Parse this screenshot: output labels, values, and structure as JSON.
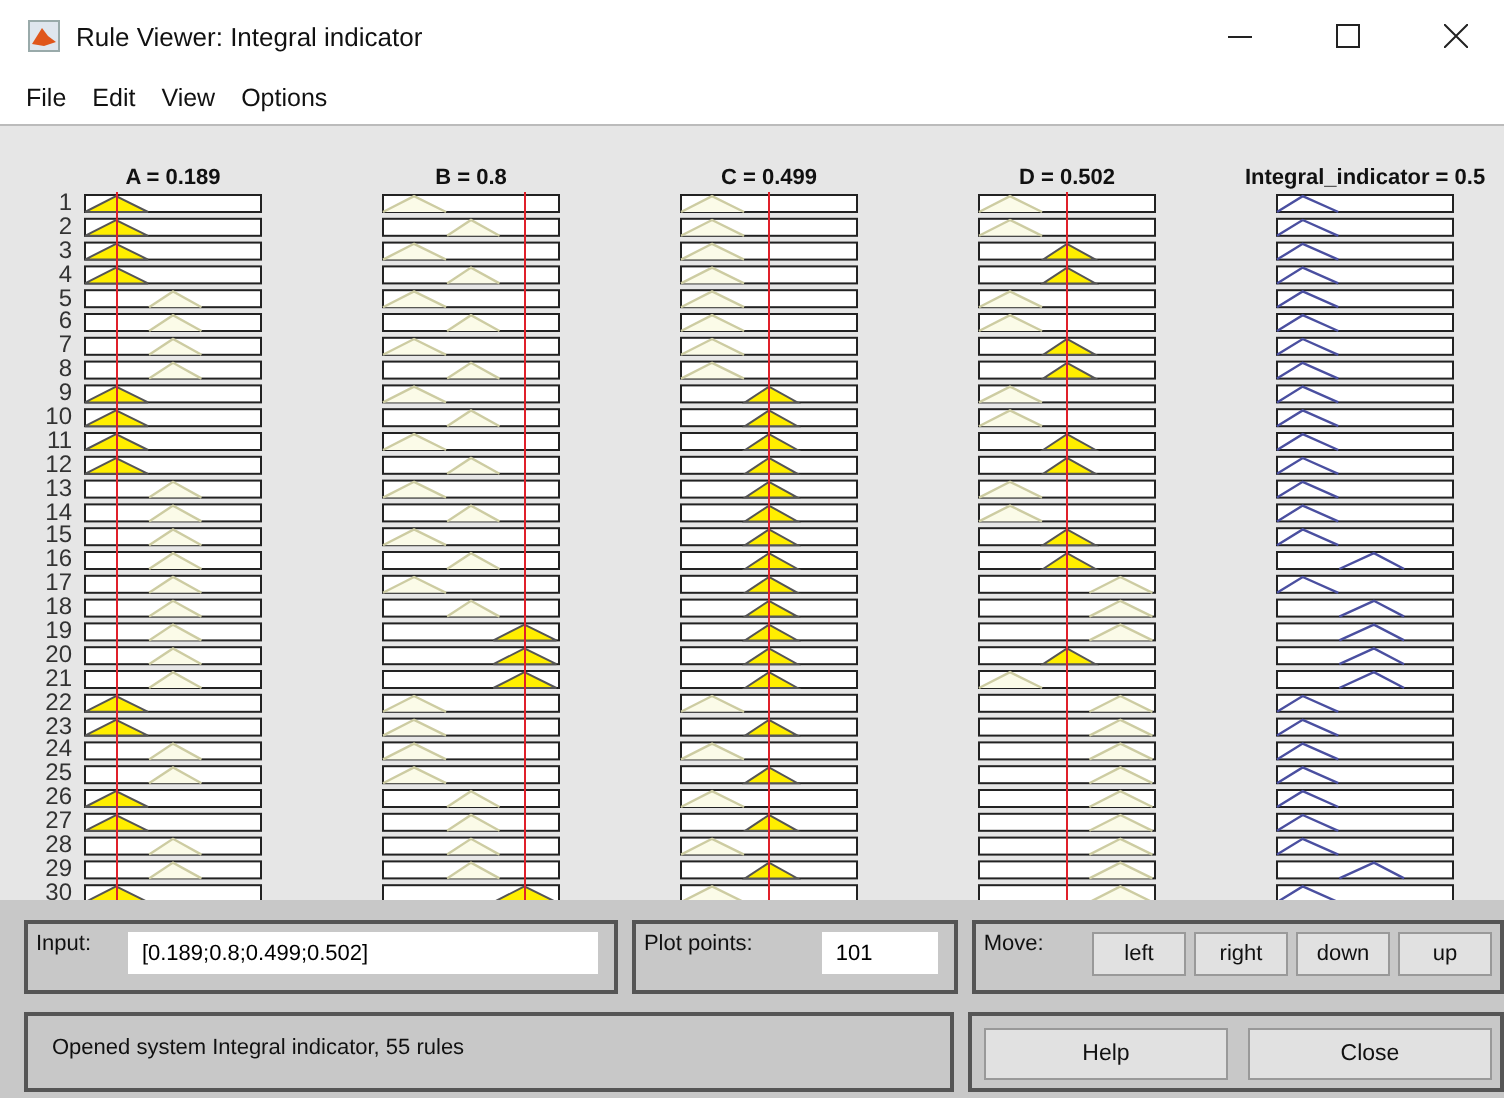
{
  "window": {
    "title": "Rule Viewer: Integral indicator"
  },
  "menu": [
    "File",
    "Edit",
    "View",
    "Options"
  ],
  "variables": [
    {
      "label": "A = 0.189",
      "kind": "input"
    },
    {
      "label": "B = 0.8",
      "kind": "input"
    },
    {
      "label": "C = 0.499",
      "kind": "input"
    },
    {
      "label": "D = 0.502",
      "kind": "input"
    },
    {
      "label": "Integral_indicator = 0.5",
      "kind": "output"
    }
  ],
  "rules": [
    {
      "number": "1",
      "cells": [
        {
          "kind": "low",
          "fired": true
        },
        {
          "kind": "low",
          "fired": false
        },
        {
          "kind": "low",
          "fired": false
        },
        {
          "kind": "low",
          "fired": false
        },
        {
          "kind": "low"
        }
      ]
    },
    {
      "number": "2",
      "cells": [
        {
          "kind": "low",
          "fired": true
        },
        {
          "kind": "mid",
          "fired": false
        },
        {
          "kind": "low",
          "fired": false
        },
        {
          "kind": "low",
          "fired": false
        },
        {
          "kind": "low"
        }
      ]
    },
    {
      "number": "3",
      "cells": [
        {
          "kind": "low",
          "fired": true
        },
        {
          "kind": "low",
          "fired": false
        },
        {
          "kind": "low",
          "fired": false
        },
        {
          "kind": "mid",
          "fired": true
        },
        {
          "kind": "low"
        }
      ]
    },
    {
      "number": "4",
      "cells": [
        {
          "kind": "low",
          "fired": true
        },
        {
          "kind": "mid",
          "fired": false
        },
        {
          "kind": "low",
          "fired": false
        },
        {
          "kind": "mid",
          "fired": true
        },
        {
          "kind": "low"
        }
      ]
    },
    {
      "number": "5",
      "cells": [
        {
          "kind": "mid",
          "fired": false
        },
        {
          "kind": "low",
          "fired": false
        },
        {
          "kind": "low",
          "fired": false
        },
        {
          "kind": "low",
          "fired": false
        },
        {
          "kind": "low"
        }
      ]
    },
    {
      "number": "6",
      "cells": [
        {
          "kind": "mid",
          "fired": false
        },
        {
          "kind": "mid",
          "fired": false
        },
        {
          "kind": "low",
          "fired": false
        },
        {
          "kind": "low",
          "fired": false
        },
        {
          "kind": "low"
        }
      ]
    },
    {
      "number": "7",
      "cells": [
        {
          "kind": "mid",
          "fired": false
        },
        {
          "kind": "low",
          "fired": false
        },
        {
          "kind": "low",
          "fired": false
        },
        {
          "kind": "mid",
          "fired": true
        },
        {
          "kind": "low"
        }
      ]
    },
    {
      "number": "8",
      "cells": [
        {
          "kind": "mid",
          "fired": false
        },
        {
          "kind": "mid",
          "fired": false
        },
        {
          "kind": "low",
          "fired": false
        },
        {
          "kind": "mid",
          "fired": true
        },
        {
          "kind": "low"
        }
      ]
    },
    {
      "number": "9",
      "cells": [
        {
          "kind": "low",
          "fired": true
        },
        {
          "kind": "low",
          "fired": false
        },
        {
          "kind": "mid",
          "fired": true
        },
        {
          "kind": "low",
          "fired": false
        },
        {
          "kind": "low"
        }
      ]
    },
    {
      "number": "10",
      "cells": [
        {
          "kind": "low",
          "fired": true
        },
        {
          "kind": "mid",
          "fired": false
        },
        {
          "kind": "mid",
          "fired": true
        },
        {
          "kind": "low",
          "fired": false
        },
        {
          "kind": "low"
        }
      ]
    },
    {
      "number": "11",
      "cells": [
        {
          "kind": "low",
          "fired": true
        },
        {
          "kind": "low",
          "fired": false
        },
        {
          "kind": "mid",
          "fired": true
        },
        {
          "kind": "mid",
          "fired": true
        },
        {
          "kind": "low"
        }
      ]
    },
    {
      "number": "12",
      "cells": [
        {
          "kind": "low",
          "fired": true
        },
        {
          "kind": "mid",
          "fired": false
        },
        {
          "kind": "mid",
          "fired": true
        },
        {
          "kind": "mid",
          "fired": true
        },
        {
          "kind": "low"
        }
      ]
    },
    {
      "number": "13",
      "cells": [
        {
          "kind": "mid",
          "fired": false
        },
        {
          "kind": "low",
          "fired": false
        },
        {
          "kind": "mid",
          "fired": true
        },
        {
          "kind": "low",
          "fired": false
        },
        {
          "kind": "low"
        }
      ]
    },
    {
      "number": "14",
      "cells": [
        {
          "kind": "mid",
          "fired": false
        },
        {
          "kind": "mid",
          "fired": false
        },
        {
          "kind": "mid",
          "fired": true
        },
        {
          "kind": "low",
          "fired": false
        },
        {
          "kind": "low"
        }
      ]
    },
    {
      "number": "15",
      "cells": [
        {
          "kind": "mid",
          "fired": false
        },
        {
          "kind": "low",
          "fired": false
        },
        {
          "kind": "mid",
          "fired": true
        },
        {
          "kind": "mid",
          "fired": true
        },
        {
          "kind": "low"
        }
      ]
    },
    {
      "number": "16",
      "cells": [
        {
          "kind": "mid",
          "fired": false
        },
        {
          "kind": "mid",
          "fired": false
        },
        {
          "kind": "mid",
          "fired": true
        },
        {
          "kind": "mid",
          "fired": true
        },
        {
          "kind": "mid"
        }
      ]
    },
    {
      "number": "17",
      "cells": [
        {
          "kind": "mid",
          "fired": false
        },
        {
          "kind": "low",
          "fired": false
        },
        {
          "kind": "mid",
          "fired": true
        },
        {
          "kind": "high",
          "fired": false
        },
        {
          "kind": "low"
        }
      ]
    },
    {
      "number": "18",
      "cells": [
        {
          "kind": "mid",
          "fired": false
        },
        {
          "kind": "mid",
          "fired": false
        },
        {
          "kind": "mid",
          "fired": true
        },
        {
          "kind": "high",
          "fired": false
        },
        {
          "kind": "mid"
        }
      ]
    },
    {
      "number": "19",
      "cells": [
        {
          "kind": "mid",
          "fired": false
        },
        {
          "kind": "high",
          "fired": true
        },
        {
          "kind": "mid",
          "fired": true
        },
        {
          "kind": "high",
          "fired": false
        },
        {
          "kind": "mid"
        }
      ]
    },
    {
      "number": "20",
      "cells": [
        {
          "kind": "mid",
          "fired": false
        },
        {
          "kind": "high",
          "fired": true
        },
        {
          "kind": "mid",
          "fired": true
        },
        {
          "kind": "mid",
          "fired": true
        },
        {
          "kind": "mid"
        }
      ]
    },
    {
      "number": "21",
      "cells": [
        {
          "kind": "mid",
          "fired": false
        },
        {
          "kind": "high",
          "fired": true
        },
        {
          "kind": "mid",
          "fired": true
        },
        {
          "kind": "low",
          "fired": false
        },
        {
          "kind": "mid"
        }
      ]
    },
    {
      "number": "22",
      "cells": [
        {
          "kind": "low",
          "fired": true
        },
        {
          "kind": "low",
          "fired": false
        },
        {
          "kind": "low",
          "fired": false
        },
        {
          "kind": "high",
          "fired": false
        },
        {
          "kind": "low"
        }
      ]
    },
    {
      "number": "23",
      "cells": [
        {
          "kind": "low",
          "fired": true
        },
        {
          "kind": "low",
          "fired": false
        },
        {
          "kind": "mid",
          "fired": true
        },
        {
          "kind": "high",
          "fired": false
        },
        {
          "kind": "low"
        }
      ]
    },
    {
      "number": "24",
      "cells": [
        {
          "kind": "mid",
          "fired": false
        },
        {
          "kind": "low",
          "fired": false
        },
        {
          "kind": "low",
          "fired": false
        },
        {
          "kind": "high",
          "fired": false
        },
        {
          "kind": "low"
        }
      ]
    },
    {
      "number": "25",
      "cells": [
        {
          "kind": "mid",
          "fired": false
        },
        {
          "kind": "low",
          "fired": false
        },
        {
          "kind": "mid",
          "fired": true
        },
        {
          "kind": "high",
          "fired": false
        },
        {
          "kind": "low"
        }
      ]
    },
    {
      "number": "26",
      "cells": [
        {
          "kind": "low",
          "fired": true
        },
        {
          "kind": "mid",
          "fired": false
        },
        {
          "kind": "low",
          "fired": false
        },
        {
          "kind": "high",
          "fired": false
        },
        {
          "kind": "low"
        }
      ]
    },
    {
      "number": "27",
      "cells": [
        {
          "kind": "low",
          "fired": true
        },
        {
          "kind": "mid",
          "fired": false
        },
        {
          "kind": "mid",
          "fired": true
        },
        {
          "kind": "high",
          "fired": false
        },
        {
          "kind": "low"
        }
      ]
    },
    {
      "number": "28",
      "cells": [
        {
          "kind": "mid",
          "fired": false
        },
        {
          "kind": "mid",
          "fired": false
        },
        {
          "kind": "low",
          "fired": false
        },
        {
          "kind": "high",
          "fired": false
        },
        {
          "kind": "low"
        }
      ]
    },
    {
      "number": "29",
      "cells": [
        {
          "kind": "mid",
          "fired": false
        },
        {
          "kind": "mid",
          "fired": false
        },
        {
          "kind": "mid",
          "fired": true
        },
        {
          "kind": "high",
          "fired": false
        },
        {
          "kind": "mid"
        }
      ]
    },
    {
      "number": "30",
      "cells": [
        {
          "kind": "low",
          "fired": true
        },
        {
          "kind": "high",
          "fired": true
        },
        {
          "kind": "low",
          "fired": false
        },
        {
          "kind": "high",
          "fired": false
        },
        {
          "kind": "low"
        }
      ]
    }
  ],
  "input": {
    "label": "Input:",
    "value": "[0.189;0.8;0.499;0.502]"
  },
  "plot_points": {
    "label": "Plot points:",
    "value": "101"
  },
  "move": {
    "label": "Move:",
    "buttons": [
      "left",
      "right",
      "down",
      "up"
    ]
  },
  "status": "Opened system Integral indicator, 55 rules",
  "buttons": [
    "Help",
    "Close"
  ]
}
